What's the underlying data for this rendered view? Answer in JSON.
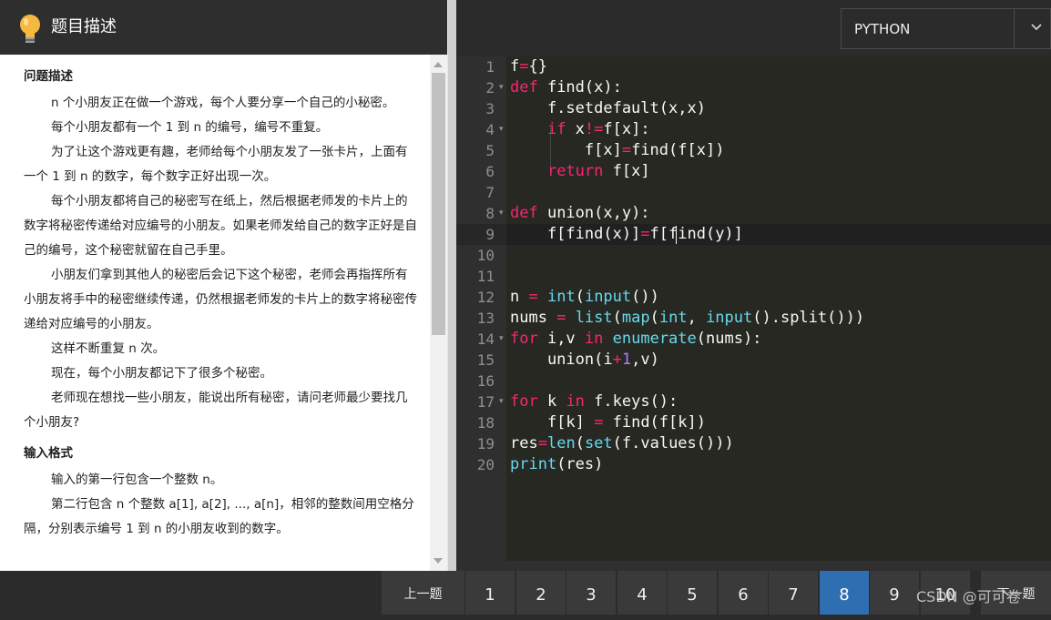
{
  "problem_panel": {
    "title": "题目描述",
    "sections": [
      {
        "heading": "问题描述",
        "paragraphs": [
          "n 个小朋友正在做一个游戏，每个人要分享一个自己的小秘密。",
          "每个小朋友都有一个 1 到 n 的编号，编号不重复。",
          "为了让这个游戏更有趣，老师给每个小朋友发了一张卡片，上面有一个 1 到 n 的数字，每个数字正好出现一次。",
          "每个小朋友都将自己的秘密写在纸上，然后根据老师发的卡片上的数字将秘密传递给对应编号的小朋友。如果老师发给自己的数字正好是自己的编号，这个秘密就留在自己手里。",
          "小朋友们拿到其他人的秘密后会记下这个秘密，老师会再指挥所有小朋友将手中的秘密继续传递，仍然根据老师发的卡片上的数字将秘密传递给对应编号的小朋友。",
          "这样不断重复 n 次。",
          "现在，每个小朋友都记下了很多个秘密。",
          "老师现在想找一些小朋友，能说出所有秘密，请问老师最少要找几个小朋友?"
        ]
      },
      {
        "heading": "输入格式",
        "paragraphs": [
          "输入的第一行包含一个整数 n。",
          "第二行包含 n 个整数 a[1], a[2], ..., a[n]，相邻的整数间用空格分隔，分别表示编号 1 到 n 的小朋友收到的数字。"
        ]
      }
    ]
  },
  "editor": {
    "language": "PYTHON",
    "line_numbers": [
      "1",
      "2",
      "3",
      "4",
      "5",
      "6",
      "7",
      "8",
      "9",
      "10",
      "11",
      "12",
      "13",
      "14",
      "15",
      "16",
      "17",
      "18",
      "19",
      "20"
    ],
    "code": [
      "f={}",
      "def find(x):",
      "    f.setdefault(x,x)",
      "    if x!=f[x]:",
      "        f[x]=find(f[x])",
      "    return f[x]",
      "",
      "def union(x,y):",
      "    f[find(x)]=f[find(y)]",
      "",
      "",
      "n = int(input())",
      "nums = list(map(int, input().split()))",
      "for i,v in enumerate(nums):",
      "    union(i+1,v)",
      "",
      "for k in f.keys():",
      "    f[k] = find(f[k])",
      "res=len(set(f.values()))",
      "print(res)"
    ],
    "active_line": 9,
    "fold_lines": [
      2,
      4,
      8,
      14,
      17
    ],
    "colors": {
      "keyword": "#f92672",
      "builtin": "#66d9ef",
      "number": "#ae81ff",
      "text": "#f8f8f2",
      "background": "#272822"
    }
  },
  "pagination": {
    "prev_label": "上一题",
    "pages": [
      "1",
      "2",
      "3",
      "4",
      "5",
      "6",
      "7",
      "8",
      "9",
      "10"
    ],
    "active_page": "8",
    "next_label": "下一题",
    "active_color": "#2e6fb2"
  },
  "watermark": "CSDN @可可卷",
  "icons": {
    "header_icon": "lightbulb-icon",
    "dropdown": "chevron-down-icon"
  }
}
